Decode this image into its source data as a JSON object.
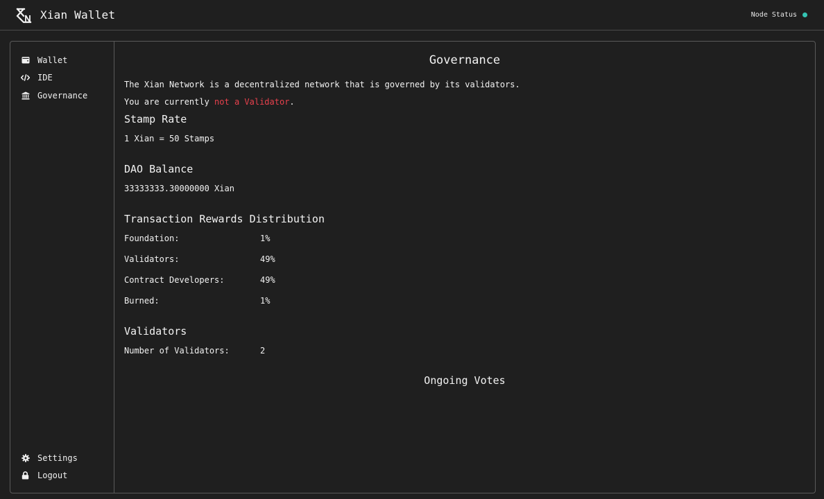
{
  "header": {
    "app_title": "Xian Wallet",
    "node_status_label": "Node Status",
    "status_color": "#34c4b3"
  },
  "sidebar": {
    "items": [
      {
        "label": "Wallet",
        "icon": "wallet-icon"
      },
      {
        "label": "IDE",
        "icon": "code-icon"
      },
      {
        "label": "Governance",
        "icon": "bank-icon"
      }
    ],
    "bottom_items": [
      {
        "label": "Settings",
        "icon": "gear-icon"
      },
      {
        "label": "Logout",
        "icon": "lock-icon"
      }
    ]
  },
  "main": {
    "title": "Governance",
    "intro": "The Xian Network is a decentralized network that is governed by its validators.",
    "validator_prefix": "You are currently ",
    "validator_status": "not a Validator",
    "validator_suffix": ".",
    "stamp_rate": {
      "heading": "Stamp Rate",
      "value": "1 Xian = 50 Stamps"
    },
    "dao_balance": {
      "heading": "DAO Balance",
      "value": "33333333.30000000 Xian"
    },
    "rewards": {
      "heading": "Transaction Rewards Distribution",
      "rows": [
        {
          "label": "Foundation:",
          "value": "1%"
        },
        {
          "label": "Validators:",
          "value": "49%"
        },
        {
          "label": "Contract Developers:",
          "value": "49%"
        },
        {
          "label": "Burned:",
          "value": "1%"
        }
      ]
    },
    "validators": {
      "heading": "Validators",
      "count_label": "Number of Validators:",
      "count_value": "2"
    },
    "ongoing_votes_heading": "Ongoing Votes"
  },
  "colors": {
    "background": "#1f1f1f",
    "accent_red": "#e8414d",
    "border": "#5a5a5a"
  }
}
